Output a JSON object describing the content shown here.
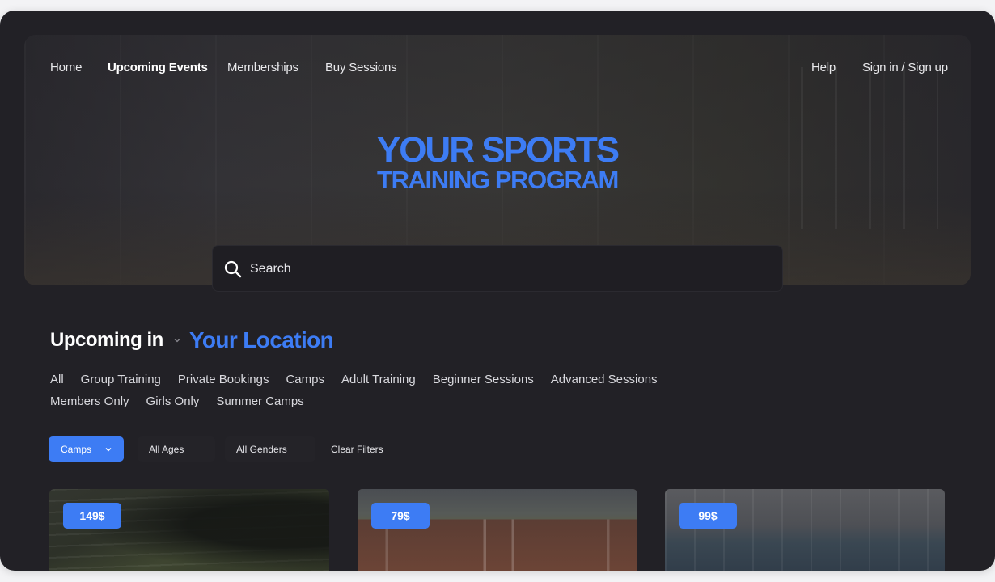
{
  "nav": {
    "left": [
      "Home",
      "Upcoming Events",
      "Memberships",
      "Buy Sessions"
    ],
    "active": "Upcoming Events",
    "help": "Help",
    "signin": "Sign in / Sign up"
  },
  "hero": {
    "title_line1": "YOUR SPORTS",
    "title_line2": "TRAINING PROGRAM",
    "search_placeholder": "Search"
  },
  "upcoming": {
    "label": "Upcoming in",
    "location": "Your Location"
  },
  "categories": [
    "All",
    "Group Training",
    "Private Bookings",
    "Camps",
    "Adult Training",
    "Beginner Sessions",
    "Advanced Sessions",
    "Members Only",
    "Girls Only",
    "Summer Camps"
  ],
  "filters": {
    "type_value": "Camps",
    "ages": "All Ages",
    "genders": "All Genders",
    "clear": "Clear Filters"
  },
  "cards": [
    {
      "price": "149$"
    },
    {
      "price": "79$"
    },
    {
      "price": "99$"
    }
  ],
  "colors": {
    "accent": "#3d7cf4",
    "background": "#222126",
    "text": "#e9e9ec"
  }
}
